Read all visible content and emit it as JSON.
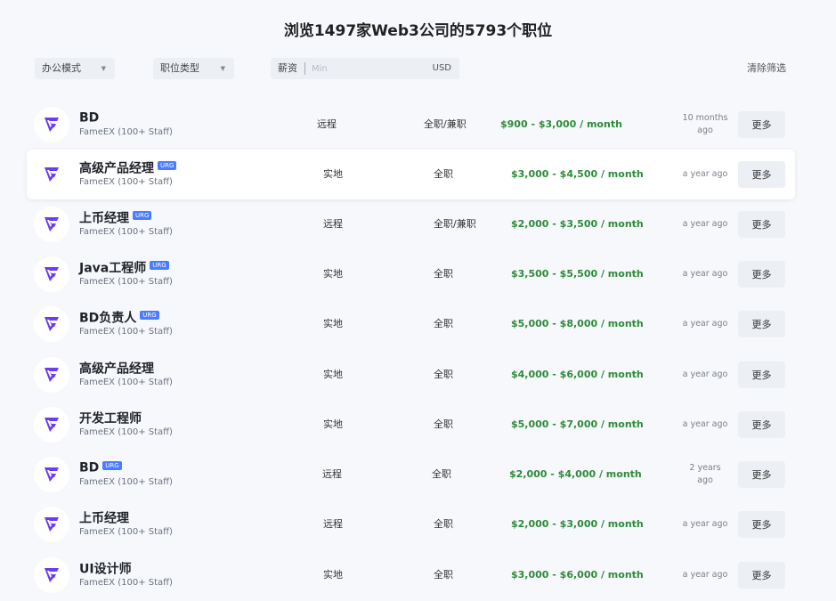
{
  "header": {
    "title": "浏览1497家Web3公司的5793个职位"
  },
  "filters": {
    "work_mode": "办公模式",
    "job_type": "职位类型",
    "salary_label": "薪资",
    "salary_placeholder": "Min",
    "currency": "USD",
    "clear": "清除筛选"
  },
  "more_label": "更多",
  "urg_badge": "URG",
  "brand_color": "#6c3cf2",
  "pay_color": "#2e8b3a",
  "jobs": [
    {
      "title": "BD",
      "urg": false,
      "company": "FameEX (100+ Staff)",
      "mode": "远程",
      "type": "全职/兼职",
      "salary": "$900 - $3,000 / month",
      "posted": "10 months ago"
    },
    {
      "title": "高级产品经理",
      "urg": true,
      "company": "FameEX (100+ Staff)",
      "mode": "实地",
      "type": "全职",
      "salary": "$3,000 - $4,500 / month",
      "posted": "a year ago"
    },
    {
      "title": "上币经理",
      "urg": true,
      "company": "FameEX (100+ Staff)",
      "mode": "远程",
      "type": "全职/兼职",
      "salary": "$2,000 - $3,500 / month",
      "posted": "a year ago"
    },
    {
      "title": "Java工程师",
      "urg": true,
      "company": "FameEX (100+ Staff)",
      "mode": "实地",
      "type": "全职",
      "salary": "$3,500 - $5,500 / month",
      "posted": "a year ago"
    },
    {
      "title": "BD负责人",
      "urg": true,
      "company": "FameEX (100+ Staff)",
      "mode": "实地",
      "type": "全职",
      "salary": "$5,000 - $8,000 / month",
      "posted": "a year ago"
    },
    {
      "title": "高级产品经理",
      "urg": false,
      "company": "FameEX (100+ Staff)",
      "mode": "实地",
      "type": "全职",
      "salary": "$4,000 - $6,000 / month",
      "posted": "a year ago"
    },
    {
      "title": "开发工程师",
      "urg": false,
      "company": "FameEX (100+ Staff)",
      "mode": "实地",
      "type": "全职",
      "salary": "$5,000 - $7,000 / month",
      "posted": "a year ago"
    },
    {
      "title": "BD",
      "urg": true,
      "company": "FameEX (100+ Staff)",
      "mode": "远程",
      "type": "全职",
      "salary": "$2,000 - $4,000 / month",
      "posted": "2 years ago"
    },
    {
      "title": "上币经理",
      "urg": false,
      "company": "FameEX (100+ Staff)",
      "mode": "远程",
      "type": "全职",
      "salary": "$2,000 - $3,000 / month",
      "posted": "a year ago"
    },
    {
      "title": "UI设计师",
      "urg": false,
      "company": "FameEX (100+ Staff)",
      "mode": "实地",
      "type": "全职",
      "salary": "$3,000 - $6,000 / month",
      "posted": "a year ago"
    }
  ]
}
